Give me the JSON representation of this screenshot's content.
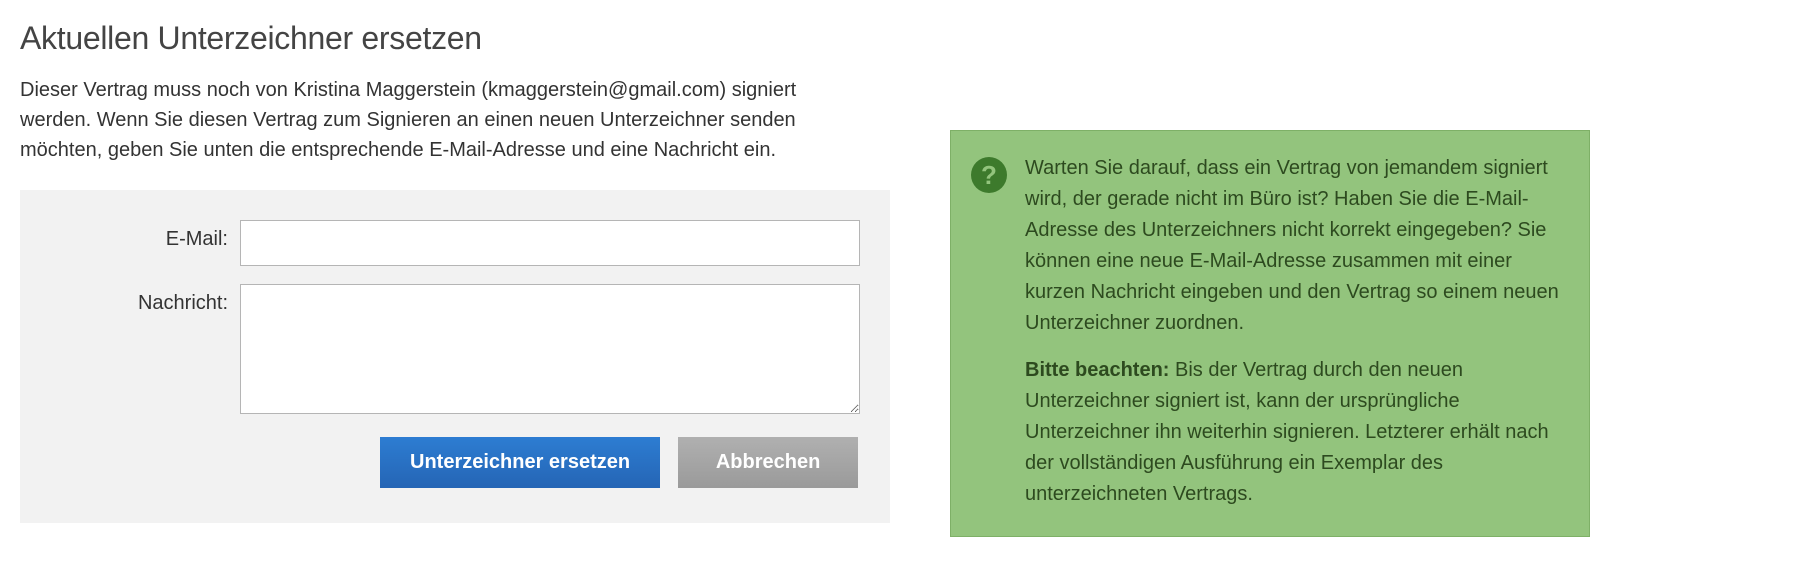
{
  "page": {
    "title": "Aktuellen Unterzeichner ersetzen",
    "description": "Dieser Vertrag muss noch von Kristina Maggerstein (kmaggerstein@gmail.com) signiert werden. Wenn Sie diesen Vertrag zum Signieren an einen neuen Unterzeichner senden möchten, geben Sie unten die entsprechende E-Mail-Adresse und eine Nachricht ein."
  },
  "form": {
    "email_label": "E-Mail:",
    "email_value": "",
    "message_label": "Nachricht:",
    "message_value": "",
    "submit_label": "Unterzeichner ersetzen",
    "cancel_label": "Abbrechen"
  },
  "info": {
    "icon_glyph": "?",
    "paragraph1": "Warten Sie darauf, dass ein Vertrag von jemandem signiert wird, der gerade nicht im Büro ist? Haben Sie die E-Mail-Adresse des Unterzeichners nicht korrekt eingegeben? Sie können eine neue E-Mail-Adresse zusammen mit einer kurzen Nachricht eingeben und den Vertrag so einem neuen Unterzeichner zuordnen.",
    "note_label": "Bitte beachten:",
    "paragraph2": " Bis der Vertrag durch den neuen Unterzeichner signiert ist, kann der ursprüngliche Unterzeichner ihn weiterhin signieren. Letzterer erhält nach der vollständigen Ausführung ein Exemplar des unterzeichneten Vertrags."
  }
}
